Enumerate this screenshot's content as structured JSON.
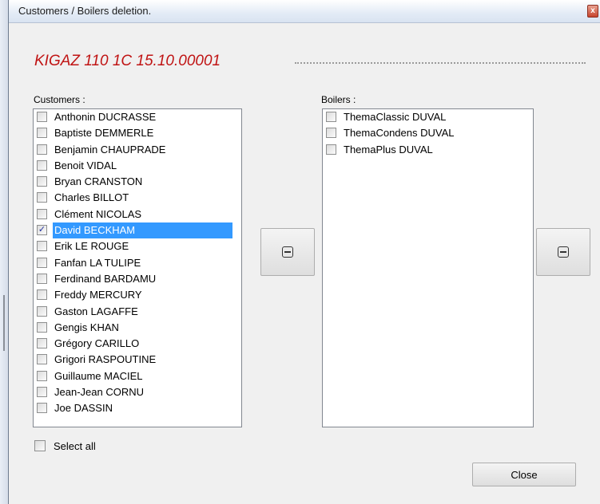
{
  "window": {
    "title": "Customers / Boilers deletion.",
    "close_glyph": "x"
  },
  "heading": "KIGAZ 110 1C 15.10.00001",
  "customers": {
    "label": "Customers :",
    "items": [
      {
        "name": "Anthonin DUCRASSE",
        "checked": false
      },
      {
        "name": "Baptiste DEMMERLE",
        "checked": false
      },
      {
        "name": "Benjamin CHAUPRADE",
        "checked": false
      },
      {
        "name": "Benoit VIDAL",
        "checked": false
      },
      {
        "name": "Bryan CRANSTON",
        "checked": false
      },
      {
        "name": "Charles BILLOT",
        "checked": false
      },
      {
        "name": "Clément NICOLAS",
        "checked": false
      },
      {
        "name": "David BECKHAM",
        "checked": true,
        "selected": true
      },
      {
        "name": "Erik LE ROUGE",
        "checked": false
      },
      {
        "name": "Fanfan LA TULIPE",
        "checked": false
      },
      {
        "name": "Ferdinand BARDAMU",
        "checked": false
      },
      {
        "name": "Freddy MERCURY",
        "checked": false
      },
      {
        "name": "Gaston LAGAFFE",
        "checked": false
      },
      {
        "name": "Gengis KHAN",
        "checked": false
      },
      {
        "name": "Grégory CARILLO",
        "checked": false
      },
      {
        "name": "Grigori RASPOUTINE",
        "checked": false
      },
      {
        "name": "Guillaume MACIEL",
        "checked": false
      },
      {
        "name": "Jean-Jean CORNU",
        "checked": false
      },
      {
        "name": "Joe DASSIN",
        "checked": false
      }
    ]
  },
  "boilers": {
    "label": "Boilers :",
    "items": [
      {
        "name": "ThemaClassic DUVAL",
        "checked": false
      },
      {
        "name": "ThemaCondens DUVAL",
        "checked": false
      },
      {
        "name": "ThemaPlus DUVAL",
        "checked": false
      }
    ]
  },
  "select_all_label": "Select all",
  "close_button_label": "Close",
  "check_glyph": "✓"
}
